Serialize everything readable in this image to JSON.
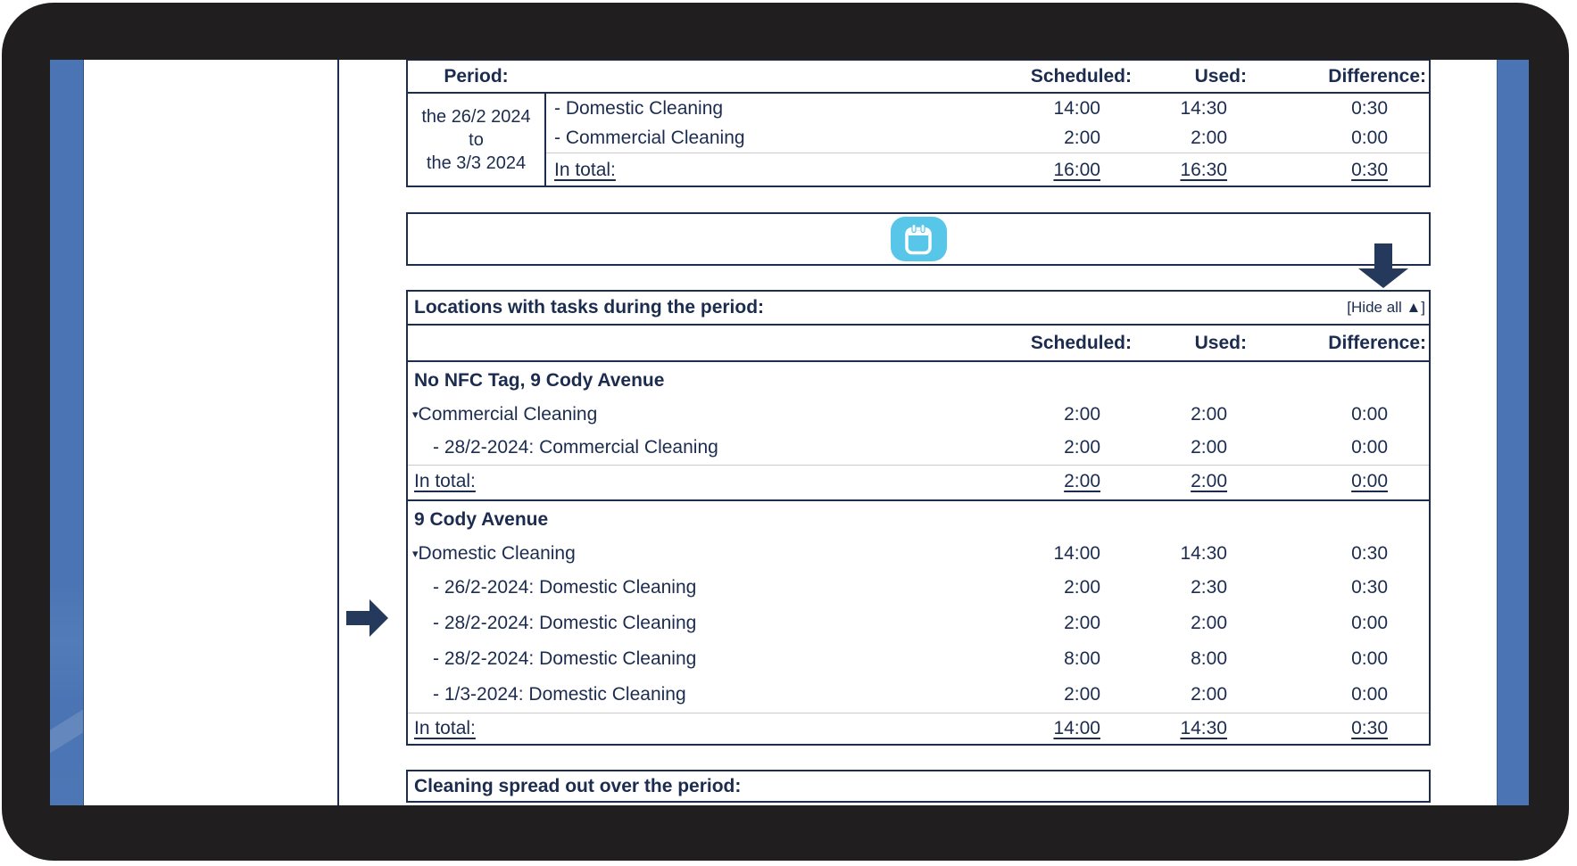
{
  "colors": {
    "navy_text": "#1c2c4f",
    "table_border": "#1d2d50",
    "gray_separator": "#cbcbcb",
    "side_bar_blue": "#4a74b3",
    "calendar_cyan": "#58c6e9",
    "frame_dark": "#201e1f",
    "annotation_arrow": "#24395c"
  },
  "icons": {
    "calendar": "calendar-icon",
    "collapse": "▾",
    "hide_all_triangle": "▲"
  },
  "period_table": {
    "headers": {
      "period": "Period:",
      "scheduled": "Scheduled:",
      "used": "Used:",
      "difference": "Difference:"
    },
    "range": {
      "line1": "the 26/2 2024",
      "line2": "to",
      "line3": "the 3/3 2024"
    },
    "rows": [
      {
        "label": "- Domestic Cleaning",
        "scheduled": "14:00",
        "used": "14:30",
        "difference": "0:30"
      },
      {
        "label": "- Commercial Cleaning",
        "scheduled": "2:00",
        "used": "2:00",
        "difference": "0:00"
      }
    ],
    "total": {
      "label": "In total:",
      "scheduled": "16:00",
      "used": "16:30",
      "difference": "0:30"
    }
  },
  "locations_table": {
    "title": "Locations with tasks during the period:",
    "hide_all_label": "[Hide all ▲]",
    "headers": {
      "scheduled": "Scheduled:",
      "used": "Used:",
      "difference": "Difference:"
    },
    "sections": [
      {
        "location": "No NFC Tag, 9 Cody Avenue",
        "group": {
          "collapse_glyph": "▾",
          "label": "Commercial Cleaning",
          "scheduled": "2:00",
          "used": "2:00",
          "difference": "0:00"
        },
        "entries": [
          {
            "label": "- 28/2-2024: Commercial Cleaning",
            "scheduled": "2:00",
            "used": "2:00",
            "difference": "0:00"
          }
        ],
        "total": {
          "label": "In total:",
          "scheduled": "2:00",
          "used": "2:00",
          "difference": "0:00"
        }
      },
      {
        "location": "9 Cody Avenue",
        "group": {
          "collapse_glyph": "▾",
          "label": "Domestic Cleaning",
          "scheduled": "14:00",
          "used": "14:30",
          "difference": "0:30"
        },
        "entries": [
          {
            "label": "- 26/2-2024: Domestic Cleaning",
            "scheduled": "2:00",
            "used": "2:30",
            "difference": "0:30"
          },
          {
            "label": "- 28/2-2024: Domestic Cleaning",
            "scheduled": "2:00",
            "used": "2:00",
            "difference": "0:00"
          },
          {
            "label": "- 28/2-2024: Domestic Cleaning",
            "scheduled": "8:00",
            "used": "8:00",
            "difference": "0:00"
          },
          {
            "label": "- 1/3-2024: Domestic Cleaning",
            "scheduled": "2:00",
            "used": "2:00",
            "difference": "0:00"
          }
        ],
        "total": {
          "label": "In total:",
          "scheduled": "14:00",
          "used": "14:30",
          "difference": "0:30"
        }
      }
    ]
  },
  "cleaning_spread": {
    "title": "Cleaning spread out over the period:"
  }
}
